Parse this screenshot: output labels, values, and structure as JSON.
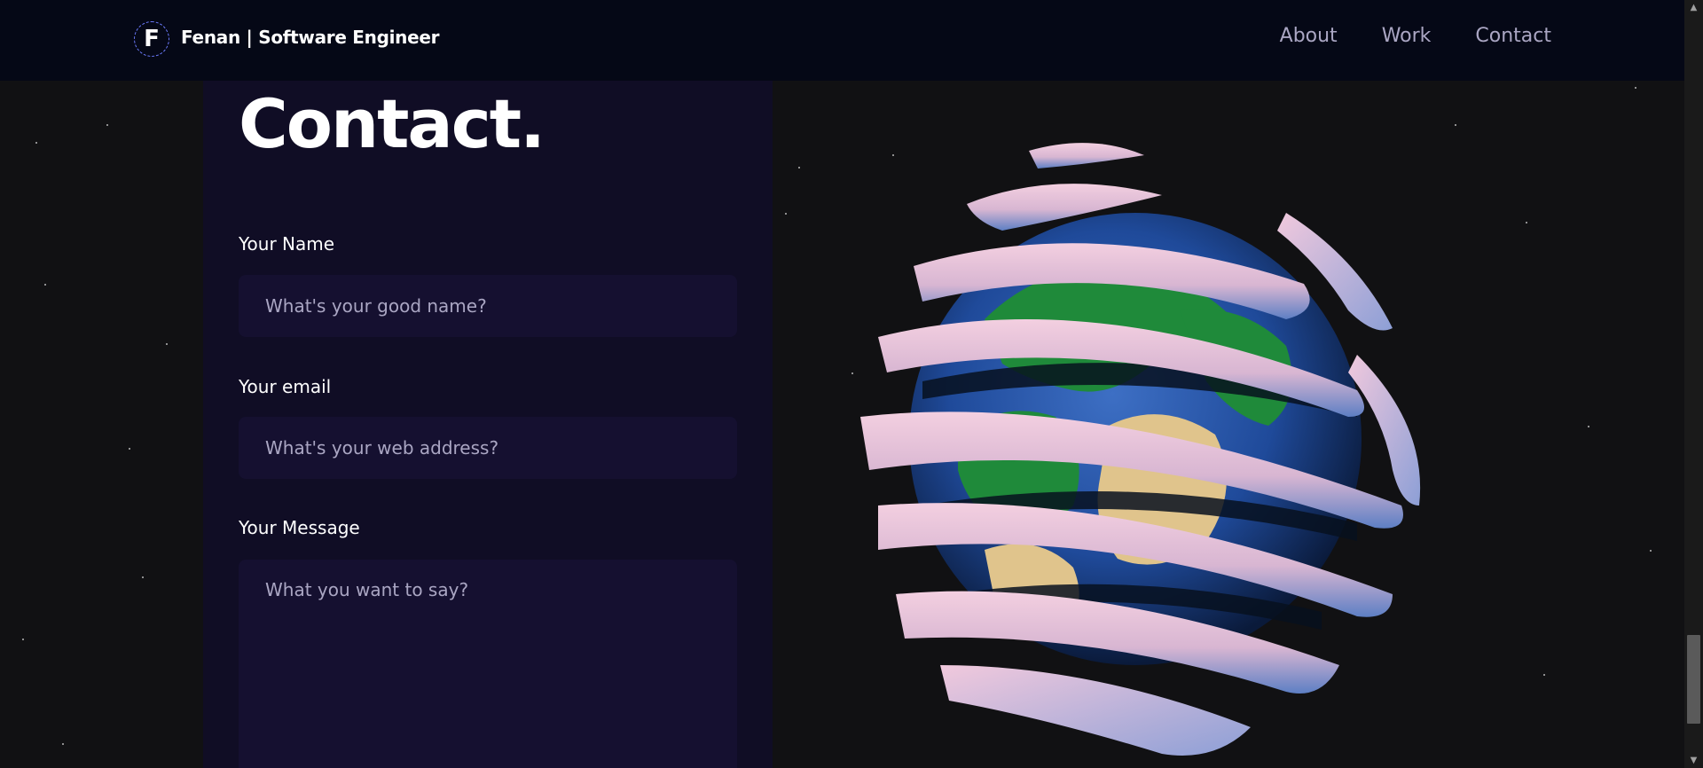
{
  "navbar": {
    "logo_letter": "F",
    "brand": "Fenan | Software Engineer",
    "links": [
      "About",
      "Work",
      "Contact"
    ]
  },
  "contact": {
    "title": "Contact.",
    "name_label": "Your Name",
    "name_placeholder": "What's your good name?",
    "email_label": "Your email",
    "email_placeholder": "What's your web address?",
    "message_label": "Your Message",
    "message_placeholder": "What you want to say?"
  },
  "colors": {
    "navbar_bg": "#050816",
    "card_bg": "#100d25",
    "input_bg": "#151030",
    "secondary_text": "#aaa6c3"
  },
  "icons": {
    "scroll_up": "▲",
    "scroll_down": "▼"
  }
}
